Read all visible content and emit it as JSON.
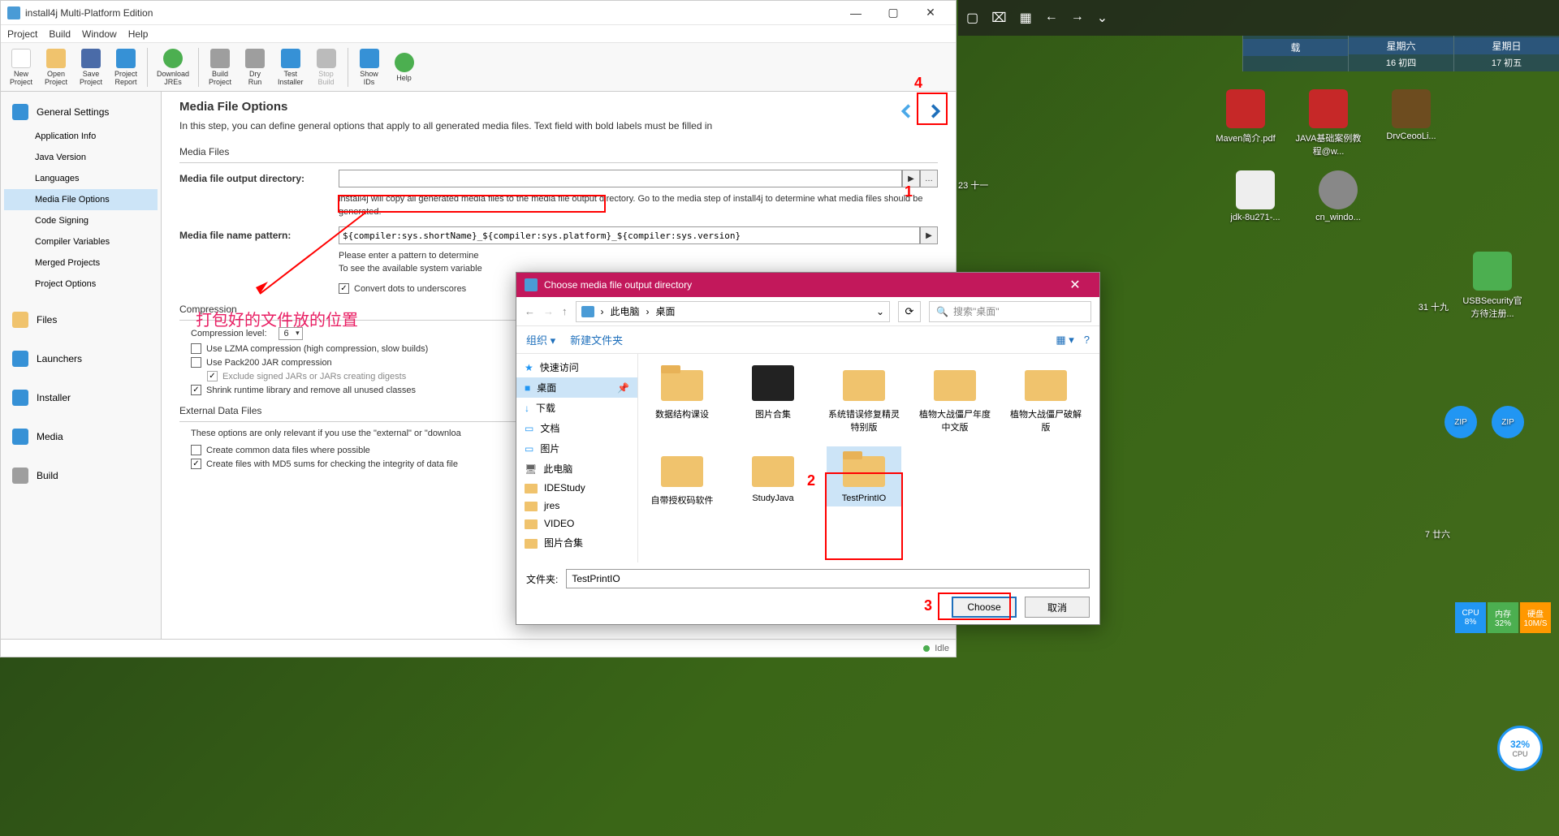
{
  "window": {
    "title": "install4j Multi-Platform Edition"
  },
  "menu": {
    "project": "Project",
    "build": "Build",
    "window": "Window",
    "help": "Help"
  },
  "toolbar": {
    "new": "New\nProject",
    "open": "Open\nProject",
    "save": "Save\nProject",
    "report": "Project\nReport",
    "jres": "Download\nJREs",
    "buildp": "Build\nProject",
    "dry": "Dry\nRun",
    "test": "Test\nInstaller",
    "stop": "Stop\nBuild",
    "ids": "Show\nIDs",
    "help": "Help"
  },
  "sidebar": {
    "general": "General Settings",
    "app_info": "Application Info",
    "java": "Java Version",
    "lang": "Languages",
    "media": "Media File Options",
    "sign": "Code Signing",
    "vars": "Compiler Variables",
    "merged": "Merged Projects",
    "proj_opt": "Project Options",
    "files": "Files",
    "launchers": "Launchers",
    "installer": "Installer",
    "media2": "Media",
    "build": "Build"
  },
  "content": {
    "title": "Media File Options",
    "desc": "In this step, you can define general options that apply to all generated media files. Text field with bold labels must be filled in",
    "media_files_group": "Media Files",
    "output_dir_label": "Media file output directory:",
    "output_dir_value": "",
    "output_dir_hint": "install4j will copy all generated media files to the media file output directory. Go to the media step of install4j to determine what media files should be generated.",
    "pattern_label": "Media file name pattern:",
    "pattern_value": "${compiler:sys.shortName}_${compiler:sys.platform}_${compiler:sys.version}",
    "pattern_hint": "Please enter a pattern to determine\nTo see the available system variable",
    "convert_dots": "Convert dots to underscores",
    "compression_group": "Compression",
    "compression_level_label": "Compression level:",
    "compression_level_value": "6",
    "lzma": "Use LZMA compression (high compression, slow builds)",
    "pack200": "Use Pack200 JAR compression",
    "exclude_signed": "Exclude signed JARs or JARs creating digests",
    "shrink": "Shrink runtime library and remove all unused classes",
    "external_group": "External Data Files",
    "external_desc": "These options are only relevant if you use the \"external\" or \"downloa",
    "common_data": "Create common data files where possible",
    "md5": "Create files with MD5 sums for checking the integrity of data file"
  },
  "status": {
    "idle": "Idle"
  },
  "annotations": {
    "n1": "1",
    "n2": "2",
    "n3": "3",
    "n4": "4",
    "text": "打包好的文件放的位置"
  },
  "file_dialog": {
    "title": "Choose media file output directory",
    "breadcrumb_pc": "此电脑",
    "breadcrumb_desktop": "桌面",
    "search_placeholder": "搜索\"桌面\"",
    "organize": "组织",
    "new_folder": "新建文件夹",
    "tree": {
      "quick": "快速访问",
      "desktop": "桌面",
      "downloads": "下载",
      "docs": "文档",
      "pics": "图片",
      "pc": "此电脑",
      "ide": "IDEStudy",
      "jres": "jres",
      "video": "VIDEO",
      "picset": "图片合集"
    },
    "files": {
      "f1": "数据结构课设",
      "f2": "图片合集",
      "f3": "系统错误修复精灵特别版",
      "f4": "植物大战僵尸年度中文版",
      "f5": "植物大战僵尸破解版",
      "f6": "自带授权码软件",
      "f7": "StudyJava",
      "f8": "TestPrintIO"
    },
    "filename_label": "文件夹:",
    "filename_value": "TestPrintIO",
    "choose": "Choose",
    "cancel": "取消"
  },
  "calendar": {
    "sat": "星期六",
    "sun": "星期日",
    "sat_date": "16 初四",
    "sun_date": "17 初五"
  },
  "desktop": {
    "d1": "Maven简介.pdf",
    "d2": "JAVA基础案例教程@w...",
    "d3": "DrvCeooLi...",
    "d4": "jdk-8u271-...",
    "d5": "cn_windo...",
    "d6": "USBSecurity官方待注册..."
  },
  "cpu": {
    "cpu_label": "CPU",
    "cpu_val": "8%",
    "mem_label": "内存",
    "mem_val": "32%",
    "disk_label": "硬盘",
    "disk_val": "10M/S",
    "dial": "32%",
    "dial_label": "CPU"
  },
  "misc": {
    "zai": "载",
    "date23": "23 十一",
    "date31": "31 十九",
    "date7": "7 廿六"
  }
}
